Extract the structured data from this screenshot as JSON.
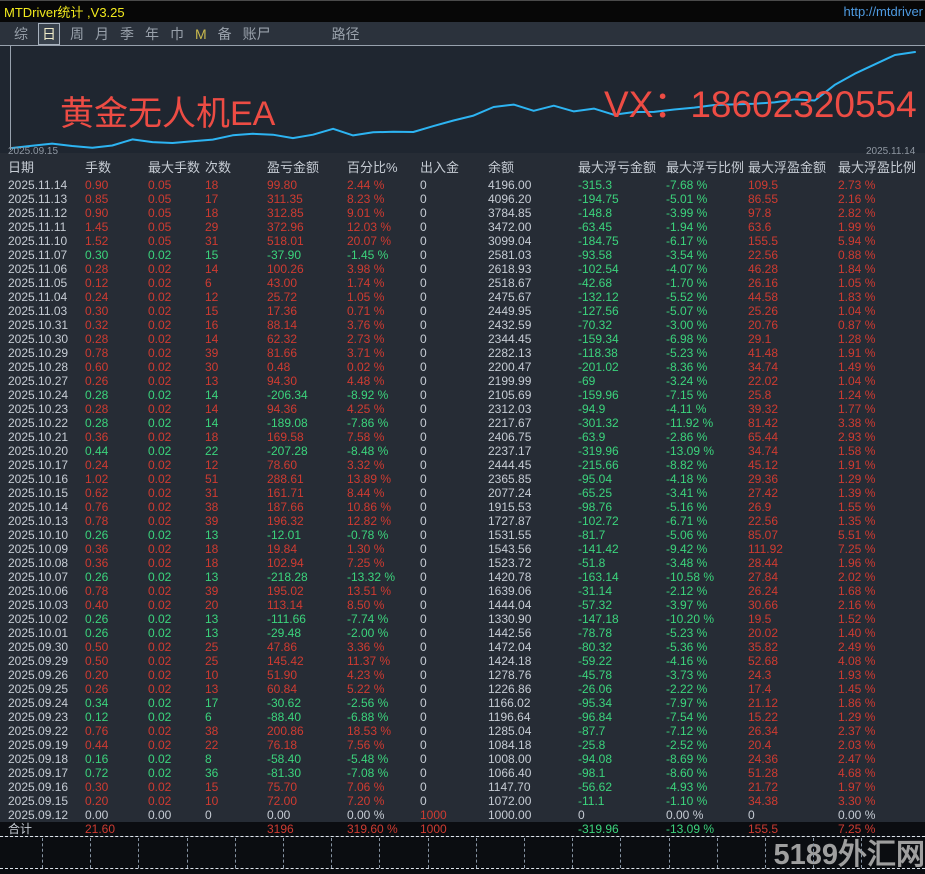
{
  "window": {
    "title": "MTDriver统计 ,V3.25",
    "url": "http://mtdriver"
  },
  "menu": {
    "items": [
      {
        "label": "综"
      },
      {
        "label": "日",
        "active": true
      },
      {
        "label": "周"
      },
      {
        "label": "月"
      },
      {
        "label": "季"
      },
      {
        "label": "年"
      },
      {
        "label": "巾"
      },
      {
        "label": "M"
      },
      {
        "label": "备"
      },
      {
        "label": "账尸"
      },
      {
        "label": "路径"
      }
    ]
  },
  "chart": {
    "label_left": "黄金无人机EA",
    "label_right": "VX：18602320554",
    "date_start": "2025.09.15",
    "date_end": "2025.11.14",
    "line_color": "#2db4f2"
  },
  "chart_data": {
    "type": "line",
    "title": "",
    "xlabel": "",
    "ylabel": "",
    "legend": [],
    "x": [
      "2025.09.12",
      "2025.09.15",
      "2025.09.16",
      "2025.09.17",
      "2025.09.18",
      "2025.09.19",
      "2025.09.22",
      "2025.09.23",
      "2025.09.24",
      "2025.09.25",
      "2025.09.26",
      "2025.09.29",
      "2025.09.30",
      "2025.10.01",
      "2025.10.02",
      "2025.10.03",
      "2025.10.06",
      "2025.10.07",
      "2025.10.08",
      "2025.10.09",
      "2025.10.10",
      "2025.10.13",
      "2025.10.14",
      "2025.10.15",
      "2025.10.16",
      "2025.10.17",
      "2025.10.20",
      "2025.10.21",
      "2025.10.22",
      "2025.10.23",
      "2025.10.24",
      "2025.10.27",
      "2025.10.28",
      "2025.10.29",
      "2025.10.30",
      "2025.10.31",
      "2025.11.03",
      "2025.11.04",
      "2025.11.05",
      "2025.11.06",
      "2025.11.07",
      "2025.11.10",
      "2025.11.11",
      "2025.11.12",
      "2025.11.13",
      "2025.11.14"
    ],
    "values": [
      1000.0,
      1072.0,
      1147.7,
      1066.4,
      1008.0,
      1084.18,
      1285.04,
      1196.64,
      1166.02,
      1226.86,
      1278.76,
      1424.18,
      1472.04,
      1442.56,
      1330.9,
      1444.04,
      1639.06,
      1420.78,
      1523.72,
      1543.56,
      1531.55,
      1727.87,
      1915.53,
      2077.24,
      2365.85,
      2444.45,
      2237.17,
      2406.75,
      2217.67,
      2312.03,
      2105.69,
      2199.99,
      2200.47,
      2282.13,
      2344.45,
      2432.59,
      2449.95,
      2475.67,
      2518.67,
      2618.93,
      2581.03,
      3099.04,
      3472.0,
      3784.85,
      4096.2,
      4196.0
    ],
    "ylim": [
      1000,
      4196
    ],
    "grid": false
  },
  "colors": {
    "red": "#cf3b31",
    "green": "#3bd47c",
    "white": "#c6ccd4",
    "curve": "#2db4f2",
    "accent_yellow": "#f2ea1e"
  },
  "table": {
    "column_keys": [
      "date",
      "lots",
      "max-lots",
      "count",
      "pnl",
      "pnl-pct",
      "deposit-withdrawal",
      "balance",
      "max-float-loss",
      "max-float-loss-pct",
      "max-float-profit",
      "max-float-profit-pct"
    ],
    "columns": [
      "日期",
      "手数",
      "最大手数",
      "次数",
      "盈亏金额",
      "百分比%",
      "出入金",
      "余额",
      "最大浮亏金额",
      "最大浮亏比例",
      "最大浮盈金额",
      "最大浮盈比例"
    ],
    "rows": [
      {
        "tone": "up",
        "cells": [
          "2025.11.14",
          "0.90",
          "0.05",
          "18",
          "99.80",
          "2.44 %",
          "0",
          "4196.00",
          "-315.3",
          "-7.68 %",
          "109.5",
          "2.73 %"
        ]
      },
      {
        "tone": "up",
        "cells": [
          "2025.11.13",
          "0.85",
          "0.05",
          "17",
          "311.35",
          "8.23 %",
          "0",
          "4096.20",
          "-194.75",
          "-5.01 %",
          "86.55",
          "2.16 %"
        ]
      },
      {
        "tone": "up",
        "cells": [
          "2025.11.12",
          "0.90",
          "0.05",
          "18",
          "312.85",
          "9.01 %",
          "0",
          "3784.85",
          "-148.8",
          "-3.99 %",
          "97.8",
          "2.82 %"
        ]
      },
      {
        "tone": "up",
        "cells": [
          "2025.11.11",
          "1.45",
          "0.05",
          "29",
          "372.96",
          "12.03 %",
          "0",
          "3472.00",
          "-63.45",
          "-1.94 %",
          "63.6",
          "1.99 %"
        ]
      },
      {
        "tone": "up",
        "cells": [
          "2025.11.10",
          "1.52",
          "0.05",
          "31",
          "518.01",
          "20.07 %",
          "0",
          "3099.04",
          "-184.75",
          "-6.17 %",
          "155.5",
          "5.94 %"
        ]
      },
      {
        "tone": "down",
        "cells": [
          "2025.11.07",
          "0.30",
          "0.02",
          "15",
          "-37.90",
          "-1.45 %",
          "0",
          "2581.03",
          "-93.58",
          "-3.54 %",
          "22.56",
          "0.88 %"
        ]
      },
      {
        "tone": "up",
        "cells": [
          "2025.11.06",
          "0.28",
          "0.02",
          "14",
          "100.26",
          "3.98 %",
          "0",
          "2618.93",
          "-102.54",
          "-4.07 %",
          "46.28",
          "1.84 %"
        ]
      },
      {
        "tone": "up",
        "cells": [
          "2025.11.05",
          "0.12",
          "0.02",
          "6",
          "43.00",
          "1.74 %",
          "0",
          "2518.67",
          "-42.68",
          "-1.70 %",
          "26.16",
          "1.05 %"
        ]
      },
      {
        "tone": "up",
        "cells": [
          "2025.11.04",
          "0.24",
          "0.02",
          "12",
          "25.72",
          "1.05 %",
          "0",
          "2475.67",
          "-132.12",
          "-5.52 %",
          "44.58",
          "1.83 %"
        ]
      },
      {
        "tone": "up",
        "cells": [
          "2025.11.03",
          "0.30",
          "0.02",
          "15",
          "17.36",
          "0.71 %",
          "0",
          "2449.95",
          "-127.56",
          "-5.07 %",
          "25.26",
          "1.04 %"
        ]
      },
      {
        "tone": "up",
        "cells": [
          "2025.10.31",
          "0.32",
          "0.02",
          "16",
          "88.14",
          "3.76 %",
          "0",
          "2432.59",
          "-70.32",
          "-3.00 %",
          "20.76",
          "0.87 %"
        ]
      },
      {
        "tone": "up",
        "cells": [
          "2025.10.30",
          "0.28",
          "0.02",
          "14",
          "62.32",
          "2.73 %",
          "0",
          "2344.45",
          "-159.34",
          "-6.98 %",
          "29.1",
          "1.28 %"
        ]
      },
      {
        "tone": "up",
        "cells": [
          "2025.10.29",
          "0.78",
          "0.02",
          "39",
          "81.66",
          "3.71 %",
          "0",
          "2282.13",
          "-118.38",
          "-5.23 %",
          "41.48",
          "1.91 %"
        ]
      },
      {
        "tone": "up",
        "cells": [
          "2025.10.28",
          "0.60",
          "0.02",
          "30",
          "0.48",
          "0.02 %",
          "0",
          "2200.47",
          "-201.02",
          "-8.36 %",
          "34.74",
          "1.49 %"
        ]
      },
      {
        "tone": "up",
        "cells": [
          "2025.10.27",
          "0.26",
          "0.02",
          "13",
          "94.30",
          "4.48 %",
          "0",
          "2199.99",
          "-69",
          "-3.24 %",
          "22.02",
          "1.04 %"
        ]
      },
      {
        "tone": "down",
        "cells": [
          "2025.10.24",
          "0.28",
          "0.02",
          "14",
          "-206.34",
          "-8.92 %",
          "0",
          "2105.69",
          "-159.96",
          "-7.15 %",
          "25.8",
          "1.24 %"
        ]
      },
      {
        "tone": "up",
        "cells": [
          "2025.10.23",
          "0.28",
          "0.02",
          "14",
          "94.36",
          "4.25 %",
          "0",
          "2312.03",
          "-94.9",
          "-4.11 %",
          "39.32",
          "1.77 %"
        ]
      },
      {
        "tone": "down",
        "cells": [
          "2025.10.22",
          "0.28",
          "0.02",
          "14",
          "-189.08",
          "-7.86 %",
          "0",
          "2217.67",
          "-301.32",
          "-11.92 %",
          "81.42",
          "3.38 %"
        ]
      },
      {
        "tone": "up",
        "cells": [
          "2025.10.21",
          "0.36",
          "0.02",
          "18",
          "169.58",
          "7.58 %",
          "0",
          "2406.75",
          "-63.9",
          "-2.86 %",
          "65.44",
          "2.93 %"
        ]
      },
      {
        "tone": "down",
        "cells": [
          "2025.10.20",
          "0.44",
          "0.02",
          "22",
          "-207.28",
          "-8.48 %",
          "0",
          "2237.17",
          "-319.96",
          "-13.09 %",
          "34.74",
          "1.58 %"
        ]
      },
      {
        "tone": "up",
        "cells": [
          "2025.10.17",
          "0.24",
          "0.02",
          "12",
          "78.60",
          "3.32 %",
          "0",
          "2444.45",
          "-215.66",
          "-8.82 %",
          "45.12",
          "1.91 %"
        ]
      },
      {
        "tone": "up",
        "cells": [
          "2025.10.16",
          "1.02",
          "0.02",
          "51",
          "288.61",
          "13.89 %",
          "0",
          "2365.85",
          "-95.04",
          "-4.18 %",
          "29.36",
          "1.29 %"
        ]
      },
      {
        "tone": "up",
        "cells": [
          "2025.10.15",
          "0.62",
          "0.02",
          "31",
          "161.71",
          "8.44 %",
          "0",
          "2077.24",
          "-65.25",
          "-3.41 %",
          "27.42",
          "1.39 %"
        ]
      },
      {
        "tone": "up",
        "cells": [
          "2025.10.14",
          "0.76",
          "0.02",
          "38",
          "187.66",
          "10.86 %",
          "0",
          "1915.53",
          "-98.76",
          "-5.16 %",
          "26.9",
          "1.55 %"
        ]
      },
      {
        "tone": "up",
        "cells": [
          "2025.10.13",
          "0.78",
          "0.02",
          "39",
          "196.32",
          "12.82 %",
          "0",
          "1727.87",
          "-102.72",
          "-6.71 %",
          "22.56",
          "1.35 %"
        ]
      },
      {
        "tone": "down",
        "cells": [
          "2025.10.10",
          "0.26",
          "0.02",
          "13",
          "-12.01",
          "-0.78 %",
          "0",
          "1531.55",
          "-81.7",
          "-5.06 %",
          "85.07",
          "5.51 %"
        ]
      },
      {
        "tone": "up",
        "cells": [
          "2025.10.09",
          "0.36",
          "0.02",
          "18",
          "19.84",
          "1.30 %",
          "0",
          "1543.56",
          "-141.42",
          "-9.42 %",
          "111.92",
          "7.25 %"
        ]
      },
      {
        "tone": "up",
        "cells": [
          "2025.10.08",
          "0.36",
          "0.02",
          "18",
          "102.94",
          "7.25 %",
          "0",
          "1523.72",
          "-51.8",
          "-3.48 %",
          "28.44",
          "1.96 %"
        ]
      },
      {
        "tone": "down",
        "cells": [
          "2025.10.07",
          "0.26",
          "0.02",
          "13",
          "-218.28",
          "-13.32 %",
          "0",
          "1420.78",
          "-163.14",
          "-10.58 %",
          "27.84",
          "2.02 %"
        ]
      },
      {
        "tone": "up",
        "cells": [
          "2025.10.06",
          "0.78",
          "0.02",
          "39",
          "195.02",
          "13.51 %",
          "0",
          "1639.06",
          "-31.14",
          "-2.12 %",
          "26.24",
          "1.68 %"
        ]
      },
      {
        "tone": "up",
        "cells": [
          "2025.10.03",
          "0.40",
          "0.02",
          "20",
          "113.14",
          "8.50 %",
          "0",
          "1444.04",
          "-57.32",
          "-3.97 %",
          "30.66",
          "2.16 %"
        ]
      },
      {
        "tone": "down",
        "cells": [
          "2025.10.02",
          "0.26",
          "0.02",
          "13",
          "-111.66",
          "-7.74 %",
          "0",
          "1330.90",
          "-147.18",
          "-10.20 %",
          "19.5",
          "1.52 %"
        ]
      },
      {
        "tone": "down",
        "cells": [
          "2025.10.01",
          "0.26",
          "0.02",
          "13",
          "-29.48",
          "-2.00 %",
          "0",
          "1442.56",
          "-78.78",
          "-5.23 %",
          "20.02",
          "1.40 %"
        ]
      },
      {
        "tone": "up",
        "cells": [
          "2025.09.30",
          "0.50",
          "0.02",
          "25",
          "47.86",
          "3.36 %",
          "0",
          "1472.04",
          "-80.32",
          "-5.36 %",
          "35.82",
          "2.49 %"
        ]
      },
      {
        "tone": "up",
        "cells": [
          "2025.09.29",
          "0.50",
          "0.02",
          "25",
          "145.42",
          "11.37 %",
          "0",
          "1424.18",
          "-59.22",
          "-4.16 %",
          "52.68",
          "4.08 %"
        ]
      },
      {
        "tone": "up",
        "cells": [
          "2025.09.26",
          "0.20",
          "0.02",
          "10",
          "51.90",
          "4.23 %",
          "0",
          "1278.76",
          "-45.78",
          "-3.73 %",
          "24.3",
          "1.93 %"
        ]
      },
      {
        "tone": "up",
        "cells": [
          "2025.09.25",
          "0.26",
          "0.02",
          "13",
          "60.84",
          "5.22 %",
          "0",
          "1226.86",
          "-26.06",
          "-2.22 %",
          "17.4",
          "1.45 %"
        ]
      },
      {
        "tone": "down",
        "cells": [
          "2025.09.24",
          "0.34",
          "0.02",
          "17",
          "-30.62",
          "-2.56 %",
          "0",
          "1166.02",
          "-95.34",
          "-7.97 %",
          "21.12",
          "1.86 %"
        ]
      },
      {
        "tone": "down",
        "cells": [
          "2025.09.23",
          "0.12",
          "0.02",
          "6",
          "-88.40",
          "-6.88 %",
          "0",
          "1196.64",
          "-96.84",
          "-7.54 %",
          "15.22",
          "1.29 %"
        ]
      },
      {
        "tone": "up",
        "cells": [
          "2025.09.22",
          "0.76",
          "0.02",
          "38",
          "200.86",
          "18.53 %",
          "0",
          "1285.04",
          "-87.7",
          "-7.12 %",
          "26.34",
          "2.37 %"
        ]
      },
      {
        "tone": "up",
        "cells": [
          "2025.09.19",
          "0.44",
          "0.02",
          "22",
          "76.18",
          "7.56 %",
          "0",
          "1084.18",
          "-25.8",
          "-2.52 %",
          "20.4",
          "2.03 %"
        ]
      },
      {
        "tone": "down",
        "cells": [
          "2025.09.18",
          "0.16",
          "0.02",
          "8",
          "-58.40",
          "-5.48 %",
          "0",
          "1008.00",
          "-94.08",
          "-8.69 %",
          "24.36",
          "2.47 %"
        ]
      },
      {
        "tone": "down",
        "cells": [
          "2025.09.17",
          "0.72",
          "0.02",
          "36",
          "-81.30",
          "-7.08 %",
          "0",
          "1066.40",
          "-98.1",
          "-8.60 %",
          "51.28",
          "4.68 %"
        ]
      },
      {
        "tone": "up",
        "cells": [
          "2025.09.16",
          "0.30",
          "0.02",
          "15",
          "75.70",
          "7.06 %",
          "0",
          "1147.70",
          "-56.62",
          "-4.93 %",
          "21.72",
          "1.97 %"
        ]
      },
      {
        "tone": "up",
        "cells": [
          "2025.09.15",
          "0.20",
          "0.02",
          "10",
          "72.00",
          "7.20 %",
          "0",
          "1072.00",
          "-11.1",
          "-1.10 %",
          "34.38",
          "3.30 %"
        ]
      },
      {
        "tone": "flat",
        "cells": [
          "2025.09.12",
          "0.00",
          "0.00",
          "0",
          "0.00",
          "0.00 %",
          "1000",
          "1000.00",
          "0",
          "0.00 %",
          "0",
          "0.00 %"
        ]
      }
    ],
    "total": {
      "tone": "up",
      "cells": [
        "合计",
        "21.60",
        "",
        "",
        "3196",
        "319.60 %",
        "1000",
        "",
        "-319.96",
        "-13.09 %",
        "155.5",
        "7.25 %"
      ]
    }
  },
  "watermark": "5189外汇网"
}
